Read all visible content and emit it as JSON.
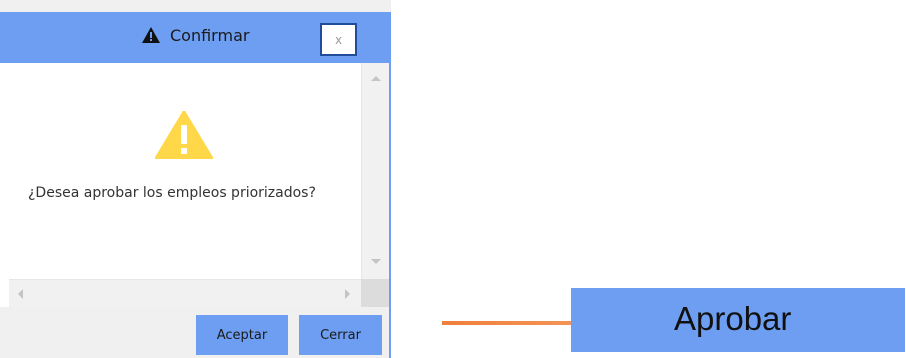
{
  "dialog": {
    "title": "Confirmar",
    "close_label": "x",
    "message": "¿Desea aprobar los empleos priorizados?",
    "buttons": {
      "accept_label": "Aceptar",
      "close_label": "Cerrar"
    }
  },
  "page": {
    "approve_label": "Aprobar"
  },
  "colors": {
    "accent_blue": "#6d9ef2",
    "warning_yellow": "#ffd84a",
    "arrow_orange": "#f07f3a"
  },
  "icons": {
    "title": "warning-icon",
    "message": "warning-icon",
    "pointer": "arrow-right-icon"
  }
}
